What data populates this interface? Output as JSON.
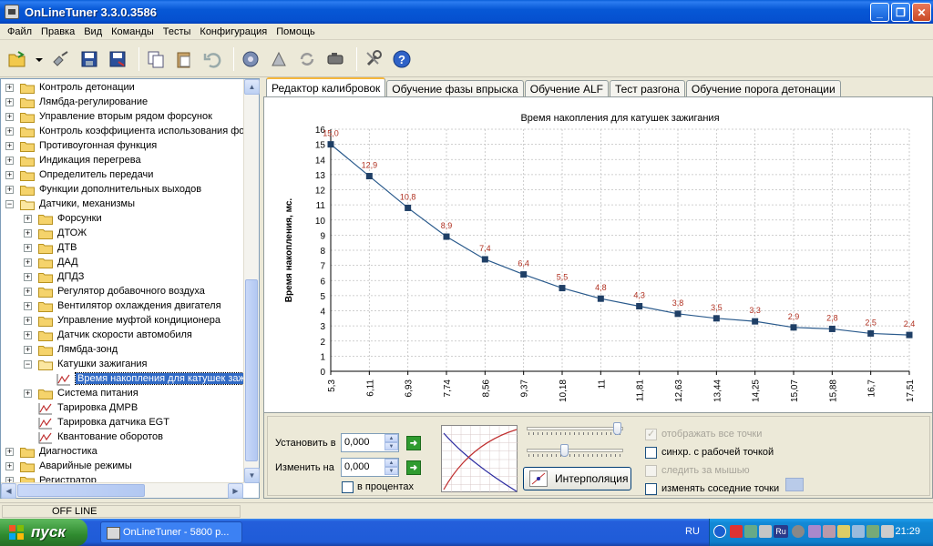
{
  "window": {
    "title": "OnLineTuner 3.3.0.3586"
  },
  "menu": [
    "Файл",
    "Правка",
    "Вид",
    "Команды",
    "Тесты",
    "Конфигурация",
    "Помощь"
  ],
  "tree": {
    "items": [
      {
        "label": "Контроль детонации",
        "level": 0,
        "expander": "+",
        "icon": "folder"
      },
      {
        "label": "Лямбда-регулирование",
        "level": 0,
        "expander": "+",
        "icon": "folder"
      },
      {
        "label": "Управление вторым рядом форсунок",
        "level": 0,
        "expander": "+",
        "icon": "folder"
      },
      {
        "label": "Контроль коэффициента использования фо",
        "level": 0,
        "expander": "+",
        "icon": "folder"
      },
      {
        "label": "Противоугонная функция",
        "level": 0,
        "expander": "+",
        "icon": "folder"
      },
      {
        "label": "Индикация перегрева",
        "level": 0,
        "expander": "+",
        "icon": "folder"
      },
      {
        "label": "Определитель передачи",
        "level": 0,
        "expander": "+",
        "icon": "folder"
      },
      {
        "label": "Функции дополнительных выходов",
        "level": 0,
        "expander": "+",
        "icon": "folder"
      },
      {
        "label": "Датчики, механизмы",
        "level": 0,
        "expander": "-",
        "icon": "folder-open"
      },
      {
        "label": "Форсунки",
        "level": 1,
        "expander": "+",
        "icon": "folder"
      },
      {
        "label": "ДТОЖ",
        "level": 1,
        "expander": "+",
        "icon": "folder"
      },
      {
        "label": "ДТВ",
        "level": 1,
        "expander": "+",
        "icon": "folder"
      },
      {
        "label": "ДАД",
        "level": 1,
        "expander": "+",
        "icon": "folder"
      },
      {
        "label": "ДПДЗ",
        "level": 1,
        "expander": "+",
        "icon": "folder"
      },
      {
        "label": "Регулятор добавочного воздуха",
        "level": 1,
        "expander": "+",
        "icon": "folder"
      },
      {
        "label": "Вентилятор охлаждения двигателя",
        "level": 1,
        "expander": "+",
        "icon": "folder"
      },
      {
        "label": "Управление муфтой кондиционера",
        "level": 1,
        "expander": "+",
        "icon": "folder"
      },
      {
        "label": "Датчик скорости автомобиля",
        "level": 1,
        "expander": "+",
        "icon": "folder"
      },
      {
        "label": "Лямбда-зонд",
        "level": 1,
        "expander": "+",
        "icon": "folder"
      },
      {
        "label": "Катушки зажигания",
        "level": 1,
        "expander": "-",
        "icon": "folder-open"
      },
      {
        "label": "Время накопления для катушек зажи",
        "level": 2,
        "expander": "",
        "icon": "chart",
        "selected": true
      },
      {
        "label": "Система питания",
        "level": 1,
        "expander": "+",
        "icon": "folder"
      },
      {
        "label": "Тарировка ДМРВ",
        "level": 1,
        "expander": "",
        "icon": "chart"
      },
      {
        "label": "Тарировка датчика EGT",
        "level": 1,
        "expander": "",
        "icon": "chart"
      },
      {
        "label": "Квантование оборотов",
        "level": 1,
        "expander": "",
        "icon": "chart"
      },
      {
        "label": "Диагностика",
        "level": 0,
        "expander": "+",
        "icon": "folder"
      },
      {
        "label": "Аварийные режимы",
        "level": 0,
        "expander": "+",
        "icon": "folder"
      },
      {
        "label": "Регистратор",
        "level": 0,
        "expander": "+",
        "icon": "folder"
      }
    ]
  },
  "tabs": [
    {
      "label": "Редактор калибровок",
      "active": true
    },
    {
      "label": "Обучение фазы впрыска",
      "active": false
    },
    {
      "label": "Обучение ALF",
      "active": false
    },
    {
      "label": "Тест разгона",
      "active": false
    },
    {
      "label": "Обучение порога детонации",
      "active": false
    }
  ],
  "chart_data": {
    "type": "line",
    "title": "Время накопления для катушек зажигания",
    "ylabel": "Время накопления, мс.",
    "xlabel": "",
    "x": [
      "5,3",
      "6,11",
      "6,93",
      "7,74",
      "8,56",
      "9,37",
      "10,18",
      "11",
      "11,81",
      "12,63",
      "13,44",
      "14,25",
      "15,07",
      "15,88",
      "16,7",
      "17,51"
    ],
    "values": [
      15.0,
      12.9,
      10.8,
      8.9,
      7.4,
      6.4,
      5.5,
      4.8,
      4.3,
      3.8,
      3.5,
      3.3,
      2.9,
      2.8,
      2.5,
      2.4
    ],
    "data_labels": [
      "15,0",
      "12,9",
      "10,8",
      "8,9",
      "7,4",
      "6,4",
      "5,5",
      "4,8",
      "4,3",
      "3,8",
      "3,5",
      "3,3",
      "2,9",
      "2,8",
      "2,5",
      "2,4"
    ],
    "ylim": [
      0,
      16
    ],
    "yticks": [
      "0",
      "1",
      "2",
      "3",
      "4",
      "5",
      "6",
      "7",
      "8",
      "9",
      "10",
      "11",
      "12",
      "13",
      "14",
      "15",
      "16"
    ],
    "grid": true,
    "colors": {
      "line": "#2a5a8c",
      "marker": "#1f3f66",
      "label": "#b03020",
      "grid": "#c0c0c0"
    }
  },
  "controls": {
    "set_label": "Установить в",
    "set_value": "0,000",
    "change_label": "Изменить на",
    "change_value": "0,000",
    "percent_label": "в процентах",
    "interp_label": "Интерполяция",
    "slider1_value": 0.98,
    "slider2_value": 0.38,
    "opt_show_all": "отображать все точки",
    "opt_sync": "синхр. с рабочей точкой",
    "opt_follow": "следить за мышью",
    "opt_neighbors": "изменять соседние точки"
  },
  "status": {
    "connection": "OFF LINE"
  },
  "taskbar": {
    "start": "пуск",
    "task": "OnLineTuner - 5800 p...",
    "lang": "RU",
    "clock": "21:29"
  }
}
